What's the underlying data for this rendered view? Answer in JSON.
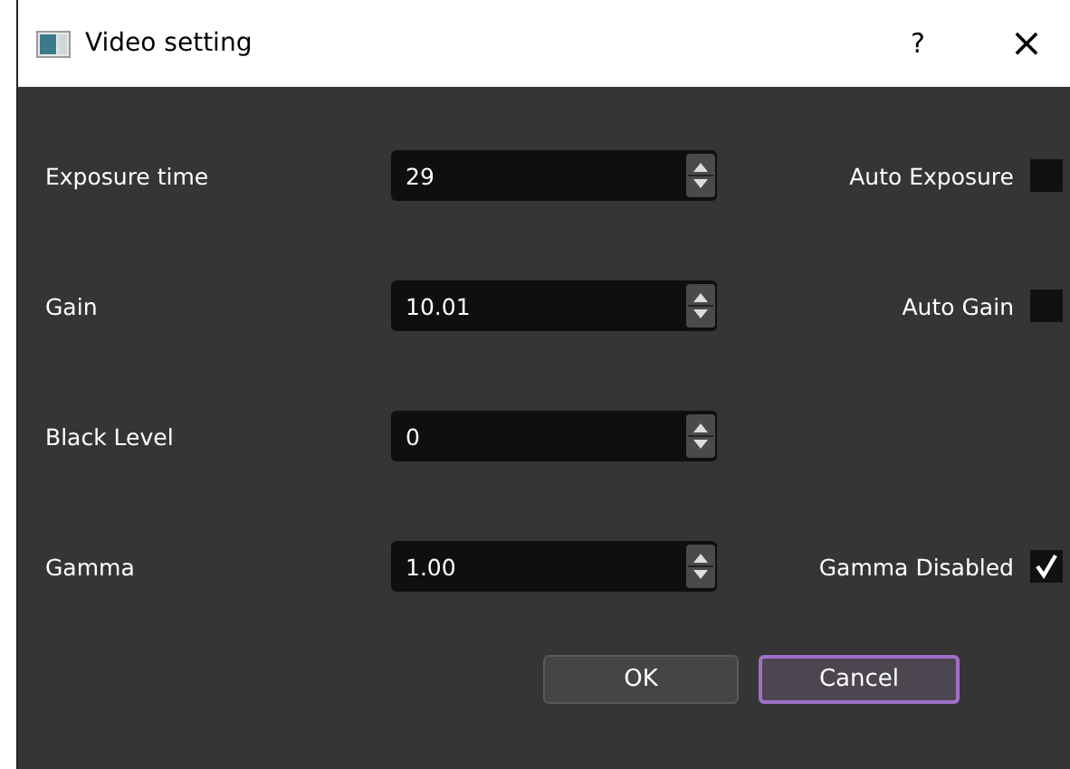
{
  "window": {
    "title": "Video setting",
    "help": "?",
    "close": "×"
  },
  "rows": [
    {
      "label": "Exposure time",
      "value": "29",
      "option": {
        "label": "Auto Exposure",
        "checked": false
      }
    },
    {
      "label": "Gain",
      "value": "10.01",
      "option": {
        "label": "Auto Gain",
        "checked": false
      }
    },
    {
      "label": "Black Level",
      "value": "0"
    },
    {
      "label": "Gamma",
      "value": "1.00",
      "option": {
        "label": "Gamma Disabled",
        "checked": true
      }
    }
  ],
  "buttons": [
    {
      "label": "OK",
      "focused": false
    },
    {
      "label": "Cancel",
      "focused": true
    }
  ]
}
